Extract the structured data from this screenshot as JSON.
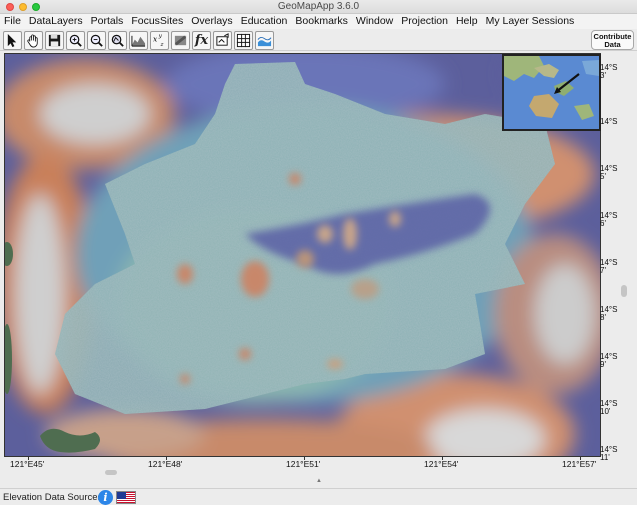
{
  "window": {
    "title": "GeoMapApp 3.6.0"
  },
  "menu": [
    "File",
    "DataLayers",
    "Portals",
    "FocusSites",
    "Overlays",
    "Education",
    "Bookmarks",
    "Window",
    "Projection",
    "Help",
    "My Layer Sessions"
  ],
  "toolbar": {
    "tools": [
      {
        "name": "select-arrow-icon",
        "glyph": "arrow"
      },
      {
        "name": "pan-hand-icon",
        "glyph": "hand"
      },
      {
        "name": "save-icon",
        "glyph": "disk"
      },
      {
        "name": "zoom-in-icon",
        "glyph": "zoom-in"
      },
      {
        "name": "zoom-out-icon",
        "glyph": "zoom-out"
      },
      {
        "name": "zoom-rect-icon",
        "glyph": "zoom-rect"
      },
      {
        "name": "profile-icon",
        "glyph": "profile"
      },
      {
        "name": "xyz-icon",
        "glyph": "xyz"
      },
      {
        "name": "contour-icon",
        "glyph": "contour"
      },
      {
        "name": "function-icon",
        "glyph": "fx"
      },
      {
        "name": "sun-illumination-icon",
        "glyph": "sun"
      },
      {
        "name": "grid-icon",
        "glyph": "grid"
      },
      {
        "name": "layers-icon",
        "glyph": "layers"
      }
    ],
    "contribute_line1": "Contribute",
    "contribute_line2": "Data"
  },
  "map": {
    "lat_labels": [
      {
        "deg": "14°S",
        "min": "3'"
      },
      {
        "deg": "14°S",
        "min": ""
      },
      {
        "deg": "14°S",
        "min": "5'"
      },
      {
        "deg": "14°S",
        "min": "6'"
      },
      {
        "deg": "14°S",
        "min": "7'"
      },
      {
        "deg": "14°S",
        "min": "8'"
      },
      {
        "deg": "14°S",
        "min": "9'"
      },
      {
        "deg": "14°S",
        "min": "10'"
      },
      {
        "deg": "14°S",
        "min": "11'"
      }
    ],
    "lon_labels": [
      "121°E45'",
      "121°E48'",
      "121°E51'",
      "121°E54'",
      "121°E57'"
    ]
  },
  "statusbar": {
    "label": "Elevation Data Sources",
    "info_glyph": "i",
    "flag": "us-flag-icon"
  }
}
